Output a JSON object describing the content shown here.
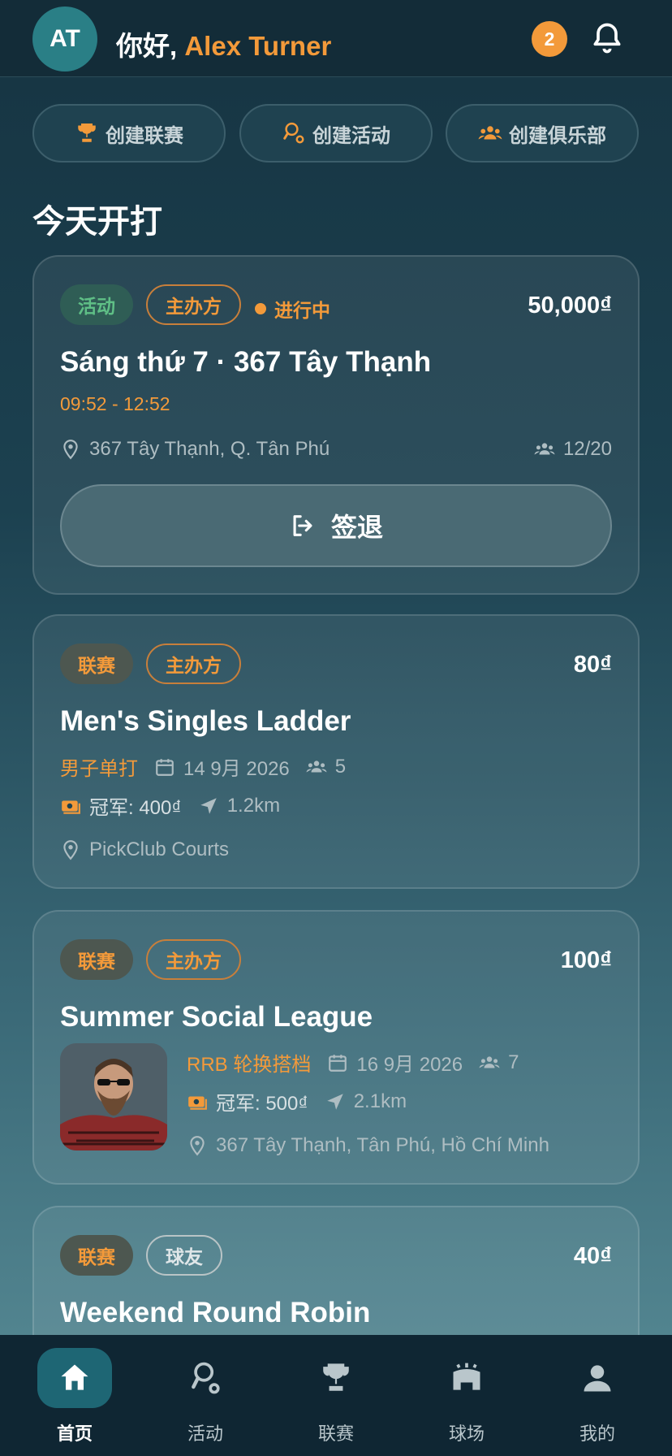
{
  "header": {
    "avatar_initials": "AT",
    "greeting_prefix": "你好, ",
    "user_name": "Alex Turner",
    "notification_count": "2"
  },
  "quick_actions": [
    {
      "label": "创建联赛",
      "icon": "trophy-icon"
    },
    {
      "label": "创建活动",
      "icon": "paddle-icon"
    },
    {
      "label": "创建俱乐部",
      "icon": "group-icon"
    }
  ],
  "section_title": "今天开打",
  "cards": [
    {
      "type_label": "活动",
      "role_label": "主办方",
      "status": "进行中",
      "price": "50,000₫",
      "title": "Sáng thứ 7 · 367 Tây Thạnh",
      "time": "09:52 - 12:52",
      "location": "367 Tây Thạnh, Q. Tân Phú",
      "participants": "12/20",
      "action_label": "签退"
    },
    {
      "type_label": "联赛",
      "role_label": "主办方",
      "price": "80₫",
      "title": "Men's Singles Ladder",
      "format": "男子单打",
      "date": "14 9月 2026",
      "players": "5",
      "prize": "冠军: 400₫",
      "distance": "1.2km",
      "location": "PickClub Courts"
    },
    {
      "type_label": "联赛",
      "role_label": "主办方",
      "price": "100₫",
      "title": "Summer Social League",
      "format": "RRB 轮换搭档",
      "date": "16 9月 2026",
      "players": "7",
      "prize": "冠军: 500₫",
      "distance": "2.1km",
      "location": "367 Tây Thạnh, Tân Phú, Hồ Chí Minh"
    },
    {
      "type_label": "联赛",
      "role_label": "球友",
      "price": "40₫",
      "title": "Weekend Round Robin"
    }
  ],
  "bottom_nav": [
    {
      "label": "首页",
      "icon": "home-icon",
      "active": true
    },
    {
      "label": "活动",
      "icon": "paddle-icon",
      "active": false
    },
    {
      "label": "联赛",
      "icon": "trophy-icon",
      "active": false
    },
    {
      "label": "球场",
      "icon": "stadium-icon",
      "active": false
    },
    {
      "label": "我的",
      "icon": "user-icon",
      "active": false
    }
  ],
  "colors": {
    "accent": "#f39a3a",
    "active_nav": "#1e6674",
    "activity_green": "#5fbf86"
  }
}
